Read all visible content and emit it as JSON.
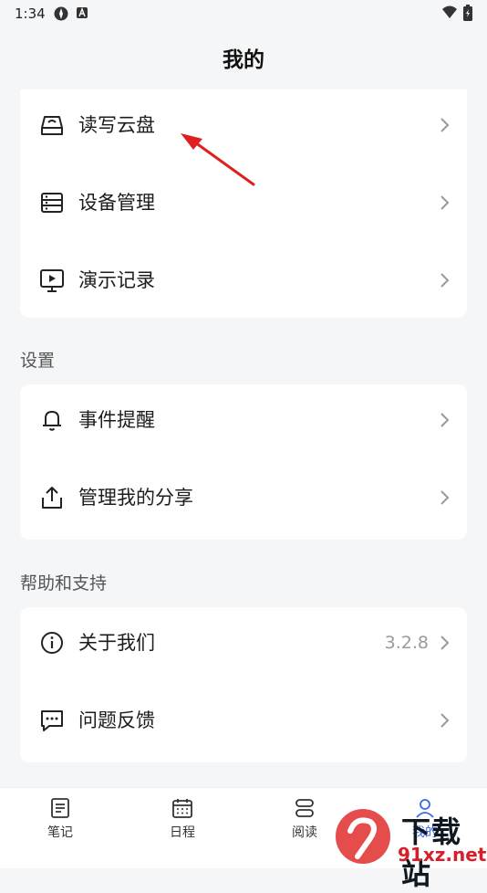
{
  "status": {
    "time": "1:34"
  },
  "header": {
    "title": "我的"
  },
  "top_items": [
    {
      "label": "读写云盘",
      "icon": "cloud-drive-icon"
    },
    {
      "label": "设备管理",
      "icon": "device-list-icon"
    },
    {
      "label": "演示记录",
      "icon": "presentation-icon"
    }
  ],
  "settings": {
    "title": "设置",
    "items": [
      {
        "label": "事件提醒",
        "icon": "bell-icon"
      },
      {
        "label": "管理我的分享",
        "icon": "share-icon"
      }
    ]
  },
  "help": {
    "title": "帮助和支持",
    "items": [
      {
        "label": "关于我们",
        "icon": "info-icon",
        "value": "3.2.8"
      },
      {
        "label": "问题反馈",
        "icon": "feedback-icon"
      }
    ]
  },
  "tabs": [
    {
      "label": "笔记",
      "icon": "notes-icon"
    },
    {
      "label": "日程",
      "icon": "calendar-icon"
    },
    {
      "label": "阅读",
      "icon": "read-icon"
    },
    {
      "label": "我的",
      "icon": "profile-icon",
      "active": true
    }
  ],
  "watermark": {
    "text_a": "下载站",
    "text_b": "91xz.net"
  },
  "colors": {
    "accent": "#3a68f0",
    "annotation": "#e02020"
  }
}
